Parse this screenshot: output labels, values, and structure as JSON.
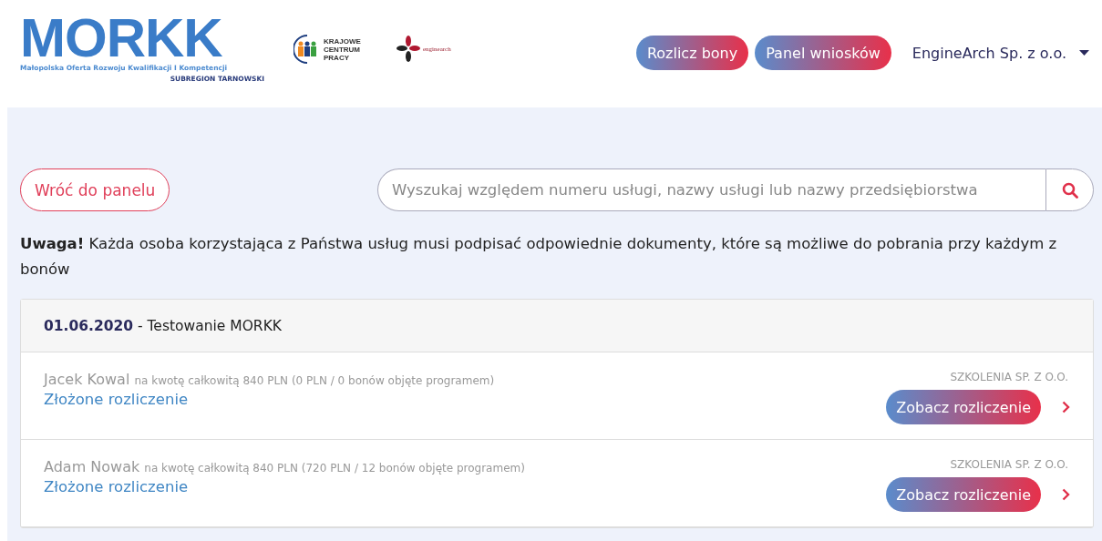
{
  "header": {
    "logo": {
      "title": "MORKK",
      "tagline": "Małopolska Oferta Rozwoju Kwalifikacji I Kompetencji",
      "subregion": "SUBREGION TARNOWSKI"
    },
    "partners": [
      {
        "kind": "kcp",
        "text": "KRAJOWE CENTRUM PRACY"
      },
      {
        "kind": "engine",
        "text": "enginearch"
      }
    ],
    "buttons": [
      "Rozlicz bony",
      "Panel wniosków"
    ],
    "account": "EngineArch Sp. z o.o."
  },
  "back_button": "Wróć do panelu",
  "search": {
    "placeholder": "Wyszukaj względem numeru usługi, nazwy usługi lub nazwy przedsiębiorstwa"
  },
  "notice": "**Uwaga!** Każda osoba korzystająca z Państwa usług musi podpisać odpowiednie dokumenty, które są możliwe do pobrania przy każdym z bonów",
  "group": {
    "date": "01.06.2020",
    "separator": " - ",
    "title": "Testowanie MORKK",
    "rows": [
      {
        "name": "Jacek Kowal",
        "details": "na kwotę całkowitą 840 PLN (0 PLN / 0 bonów objęte programem)",
        "status": "Złożone rozliczenie",
        "company": "SZKOLENIA SP. Z O.O.",
        "action": "Zobacz rozliczenie"
      },
      {
        "name": "Adam Nowak",
        "details": "na kwotę całkowitą 840 PLN (720 PLN / 12 bonów objęte programem)",
        "status": "Złożone rozliczenie",
        "company": "SZKOLENIA SP. Z O.O.",
        "action": "Zobacz rozliczenie"
      }
    ]
  }
}
